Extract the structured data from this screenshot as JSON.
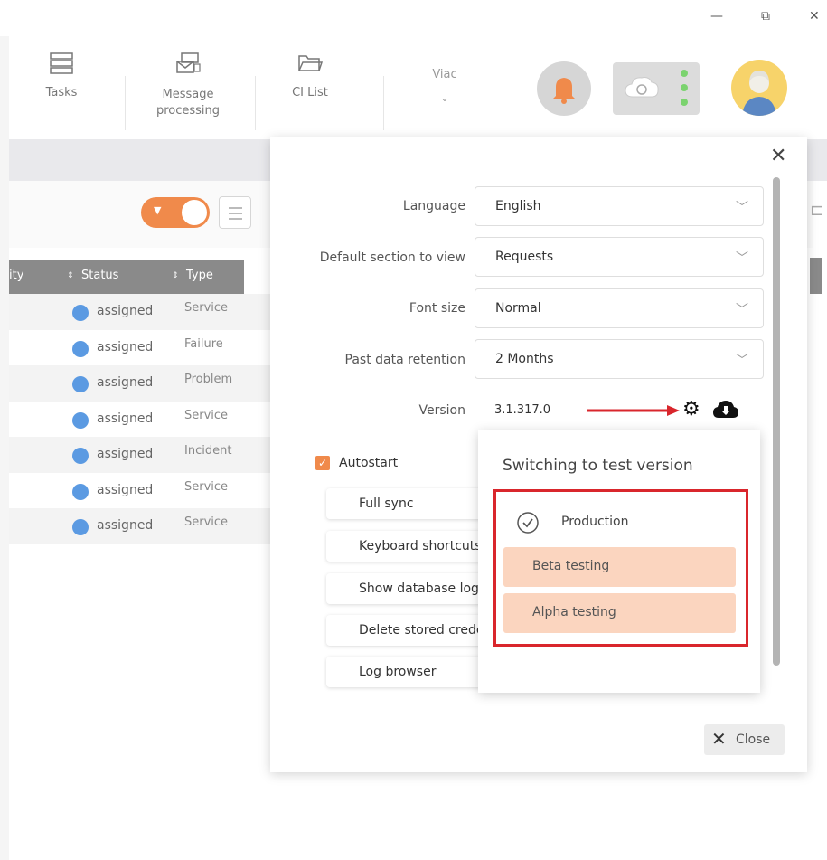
{
  "window": {
    "minimize": "—",
    "restore": "⧉",
    "close": "✕"
  },
  "toolbar": {
    "tasks": "Tasks",
    "message_line1": "Message",
    "message_line2": "processing",
    "ci_list": "CI List",
    "more": "Viac"
  },
  "table": {
    "headers": [
      "ity",
      "Status",
      "Type"
    ],
    "rows": [
      {
        "status": "assigned",
        "type": "Service"
      },
      {
        "status": "assigned",
        "type": "Failure"
      },
      {
        "status": "assigned",
        "type": "Problem"
      },
      {
        "status": "assigned",
        "type": "Service"
      },
      {
        "status": "assigned",
        "type": "Incident"
      },
      {
        "status": "assigned",
        "type": "Service"
      },
      {
        "status": "assigned",
        "type": "Service"
      }
    ]
  },
  "settings": {
    "language_label": "Language",
    "language_value": "English",
    "section_label": "Default section to view",
    "section_value": "Requests",
    "font_label": "Font size",
    "font_value": "Normal",
    "retention_label": "Past data retention",
    "retention_value": "2 Months",
    "version_label": "Version",
    "version_value": "3.1.317.0",
    "autostart": "Autostart",
    "buttons": [
      "Full sync",
      "Keyboard shortcuts",
      "Show database log",
      "Delete stored credentials",
      "Log browser"
    ],
    "close": "Close"
  },
  "version_popup": {
    "title": "Switching to test version",
    "production": "Production",
    "beta": "Beta testing",
    "alpha": "Alpha testing"
  },
  "colors": {
    "accent": "#f08a4b",
    "highlight": "#d9262c",
    "option_bg": "#fbd5bf",
    "status_dot": "#5b9ae2"
  }
}
